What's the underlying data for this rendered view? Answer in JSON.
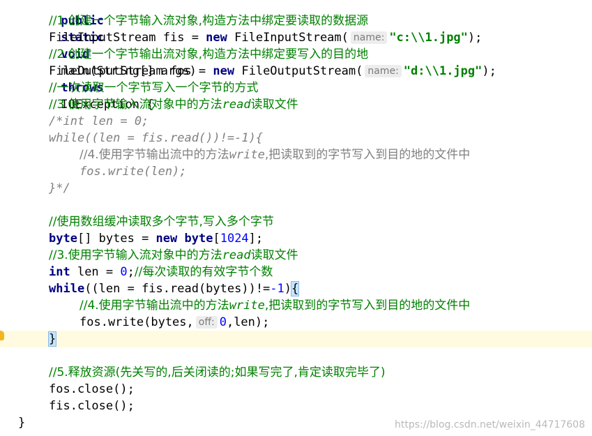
{
  "code": {
    "l0_pub": "public",
    "l0_sta": "static",
    "l0_void": "void",
    "l0_sig": "main(String[] args)",
    "l0_thr": "throws",
    "l0_exc": "IOException {",
    "l1_cm": "//1.创建一个字节输入流对象,构造方法中绑定要读取的数据源",
    "l2_a": "FileInputStream fis = ",
    "l2_new": "new",
    "l2_b": " FileInputStream(",
    "l2_hint": "name:",
    "l2_str": "\"c:\\\\1.jpg\"",
    "l2_c": ");",
    "l3_cm": "//2.创建一个字节输出流对象,构造方法中绑定要写入的目的地",
    "l4_a": "FileOutputStream fos = ",
    "l4_new": "new",
    "l4_b": " FileOutputStream(",
    "l4_hint": "name:",
    "l4_str": "\"d:\\\\1.jpg\"",
    "l4_c": ");",
    "l5_cm": "//一次读取一个字节写入一个字节的方式",
    "l6_cm_a": "//3.使用字节输入流对象中的方法",
    "l6_cm_b": "read",
    "l6_cm_c": "读取文件",
    "l7_bc": "/*int len = 0;",
    "l8_bc": "while((len = fis.read())!=-1){",
    "l9_bc_a": "//4.使用字节输出流中的方法",
    "l9_bc_b": "write",
    "l9_bc_c": ",把读取到的字节写入到目的地的文件中",
    "l10_bc": "fos.write(len);",
    "l11_bc": "}*/",
    "l13_cm": "//使用数组缓冲读取多个字节,写入多个字节",
    "l14_kw": "byte",
    "l14_a": "[] bytes = ",
    "l14_new": "new",
    "l14_kw2": "byte",
    "l14_b": "[",
    "l14_num": "1024",
    "l14_c": "];",
    "l15_cm_a": "//3.使用字节输入流对象中的方法",
    "l15_cm_b": "read",
    "l15_cm_c": "读取文件",
    "l16_kw": "int",
    "l16_a": " len = ",
    "l16_num": "0",
    "l16_b": ";",
    "l16_cm": "//每次读取的有效字节个数",
    "l17_kw": "while",
    "l17_a": "((len = fis.read(bytes))!=",
    "l17_num": "-1",
    "l17_b": ")",
    "l17_brace": "{",
    "l18_cm_a": "//4.使用字节输出流中的方法",
    "l18_cm_b": "write",
    "l18_cm_c": ",把读取到的字节写入到目的地的文件中",
    "l19_a": "fos.write(bytes,",
    "l19_hint": "off:",
    "l19_num": "0",
    "l19_b": ",len);",
    "l20_brace": "}",
    "l22_cm": "//5.释放资源(先关写的,后关闭读的;如果写完了,肯定读取完毕了)",
    "l23": "fos.close();",
    "l24": "fis.close();",
    "l25": "}"
  },
  "watermark": "https://blog.csdn.net/weixin_44717608",
  "colors": {
    "keyword": "#000080",
    "string": "#008000",
    "number": "#0000ff",
    "comment": "#008000",
    "block_comment": "#808080",
    "current_line": "#fffbe1",
    "brace_highlight": "#c7e4ff"
  }
}
